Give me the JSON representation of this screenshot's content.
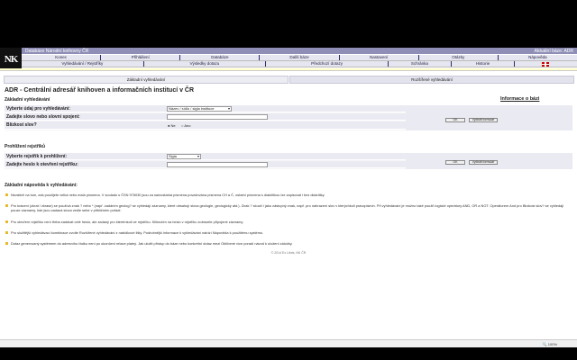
{
  "header": {
    "logo_text": "NK",
    "title_left": "Databáze Národní knihovny ČR",
    "title_right": "Aktuální báze: ADR"
  },
  "nav_row1": [
    "Konec",
    "Přihlášení",
    "Databáze",
    "Další báze",
    "Nastavení",
    "Otázky",
    "Nápověda"
  ],
  "nav_row2": [
    "Vyhledávání / Rejstříky",
    "Výsledky dotazu",
    "Předchozí dotazy",
    "Schránka",
    "Historie",
    ""
  ],
  "tabs": [
    "Základní vyhledávání",
    "Rozšířené vyhledávání"
  ],
  "page_title": "ADR - Centrální adresář knihoven a informačních institucí v ČR",
  "basic_search": {
    "section": "Základní vyhledávání",
    "help_link": "Informace o bázi",
    "field_label": "Vyberte údaj pro vyhledávání:",
    "field_value": "Název / sídlo / sigla instituce",
    "query_label": "Zadejte slovo nebo slovní spojení:",
    "proximity_label": "Blízkost slov?",
    "radio_no": "Ne",
    "radio_yes": "Ano",
    "ok_button": "OK",
    "clear_button": "Vyčistit formulář"
  },
  "index_browse": {
    "section": "Prohlížení rejstříků",
    "index_label": "Vyberte rejstřík k prohlížení:",
    "index_value": "Sigla",
    "term_label": "Zadejte heslo k otevření rejstříku:",
    "ok_button": "OK",
    "clear_button": "Vyčistit formulář"
  },
  "help": {
    "title": "Základní nápověda k vyhledávání:",
    "items": [
      "Nezáleží na tom, zda použijete velká nebo malá písmena. V souladu s ČSN 976030 jsou za samostatná písmena považována písmena CH a Č, ostatní písmena s diakritikou lze zapisovat i bez diakritiky.",
      "Pro krácení (zkrat / zkrase) se používá znak ? nebo * (např. zadáním geolog? se vyhledají záznamy, které obsahují slova geologie, geologický atd.). Znak ? slouží i jako zástupný znak, např. pro nahrazení slov v kterýchkoli pravopisech. Při vyhledávání je možno také použít logické operátory AND, OR a NOT. Operátorem And pro Blízkost slov? se vyhledají pouze záznamy, kde jsou zadaná slova vedle sebe v přibližném pořadí.",
      "Pro otevření rejstříku není třeba zadávat celé heslo, ale zadaný pro kterémkoli ve rejstříku. Kliknutím na heslo v rejstříku zobrazíte připojené záznamy.",
      "Pro složitější vyhledávací kombinace zvolte Rozšířené vyhledávání z nabídkové lišty. Podrobnější informace k vyhledávání nabízí Nápověda k použitému systému.",
      "Dotaz generovaný systémem do adresního řádku není po ukončení relace platný. Jak uložit přístup do báze nebo konkrétní dotaz mezi Oblíbené více poradí návod k uložení záložky."
    ],
    "copyright": "© 2014 Ex Libris, NK ČR"
  },
  "statusbar": {
    "zoom": "100%"
  }
}
